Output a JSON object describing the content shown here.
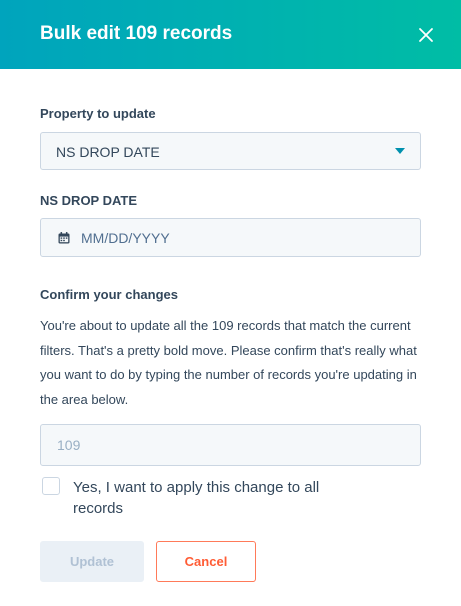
{
  "header": {
    "title": "Bulk edit 109 records",
    "close_icon": "close-icon",
    "gradient_start": "#00a4bd",
    "gradient_end": "#00bda5"
  },
  "property": {
    "label": "Property to update",
    "selected_value": "NS DROP DATE",
    "caret_icon": "caret-down-icon"
  },
  "date_field": {
    "label": "NS DROP DATE",
    "placeholder": "MM/DD/YYYY",
    "icon": "calendar-icon"
  },
  "confirm": {
    "heading": "Confirm your changes",
    "description": "You're about to update all the 109 records that match the current filters. That's a pretty bold move. Please confirm that's really what you want to do by typing the number of records you're updating in the area below.",
    "input_placeholder": "109",
    "checkbox_label": "Yes, I want to apply this change to all records",
    "checkbox_checked": false
  },
  "actions": {
    "update_label": "Update",
    "cancel_label": "Cancel",
    "cancel_color": "#ff5c35"
  }
}
